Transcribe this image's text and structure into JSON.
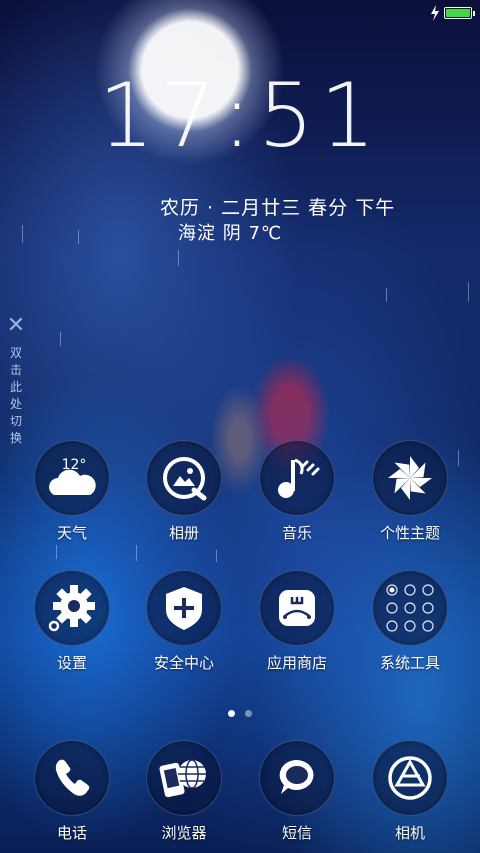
{
  "status_bar": {
    "battery_level": 1.0,
    "battery_color": "#45d64a",
    "charging": true
  },
  "lock": {
    "time": "17:51",
    "lunar_date": "农历 · 二月廿三 春分 下午",
    "weather": "海淀  阴  7℃"
  },
  "side_hint": {
    "close_icon": "close-icon",
    "text": "双击此处切换"
  },
  "apps": [
    {
      "label": "天气",
      "icon": "weather-icon",
      "temp": "12°"
    },
    {
      "label": "相册",
      "icon": "gallery-icon"
    },
    {
      "label": "音乐",
      "icon": "music-icon"
    },
    {
      "label": "个性主题",
      "icon": "theme-icon"
    },
    {
      "label": "设置",
      "icon": "settings-icon"
    },
    {
      "label": "安全中心",
      "icon": "security-icon"
    },
    {
      "label": "应用商店",
      "icon": "app-store-icon"
    },
    {
      "label": "系统工具",
      "icon": "system-tools-icon"
    }
  ],
  "page_indicator": {
    "current": 1,
    "total": 2
  },
  "dock": [
    {
      "label": "电话",
      "icon": "phone-icon"
    },
    {
      "label": "浏览器",
      "icon": "browser-icon"
    },
    {
      "label": "短信",
      "icon": "message-icon"
    },
    {
      "label": "相机",
      "icon": "camera-icon"
    }
  ]
}
